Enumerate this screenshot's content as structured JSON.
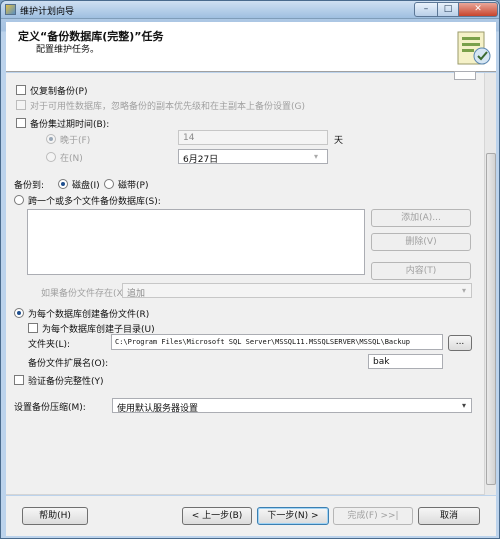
{
  "window": {
    "title": "维护计划向导",
    "controls": {
      "minimize": "–",
      "maximize": "□",
      "close": "✕"
    }
  },
  "header": {
    "title": "定义“备份数据库(完整)”任务",
    "subtitle": "配置维护任务。"
  },
  "options": {
    "copy_only_backup": {
      "label": "仅复制备份(P)",
      "checked": false
    },
    "prefer_secondary": {
      "label": "对于可用性数据库，忽略备份的副本优先级和在主副本上备份设置(G)",
      "checked": false,
      "enabled": false
    },
    "backup_set_expires": {
      "label": "备份集过期时间(B):",
      "checked": false
    },
    "expire_after": {
      "label": "晚于(F)",
      "value": "14",
      "unit": "天",
      "selected": true,
      "enabled": false
    },
    "expire_on": {
      "label": "在(N)",
      "value": "6月27日",
      "selected": false,
      "enabled": false
    }
  },
  "backup_to": {
    "label": "备份到:",
    "disk": {
      "label": "磁盘(I)",
      "selected": true
    },
    "tape": {
      "label": "磁带(P)",
      "selected": false
    }
  },
  "across_files": {
    "label": "跨一个或多个文件备份数据库(S):",
    "selected": false,
    "add_button": "添加(A)...",
    "remove_button": "删除(V)",
    "contents_button": "内容(T)",
    "if_exists_label": "如果备份文件存在(X):",
    "if_exists_value": "追加"
  },
  "per_database": {
    "label": "为每个数据库创建备份文件(R)",
    "selected": true,
    "subdir_label": "为每个数据库创建子目录(U)",
    "subdir_checked": false,
    "folder_label": "文件夹(L):",
    "folder_value": "C:\\Program Files\\Microsoft SQL Server\\MSSQL11.MSSQLSERVER\\MSSQL\\Backup",
    "browse_button": "...",
    "extension_label": "备份文件扩展名(O):",
    "extension_value": "bak"
  },
  "verify_integrity": {
    "label": "验证备份完整性(Y)",
    "checked": false
  },
  "compression": {
    "label": "设置备份压缩(M):",
    "value": "使用默认服务器设置"
  },
  "footer": {
    "help": "帮助(H)",
    "back": "< 上一步(B)",
    "next": "下一步(N) >",
    "finish": "完成(F) >>|",
    "cancel": "取消"
  }
}
